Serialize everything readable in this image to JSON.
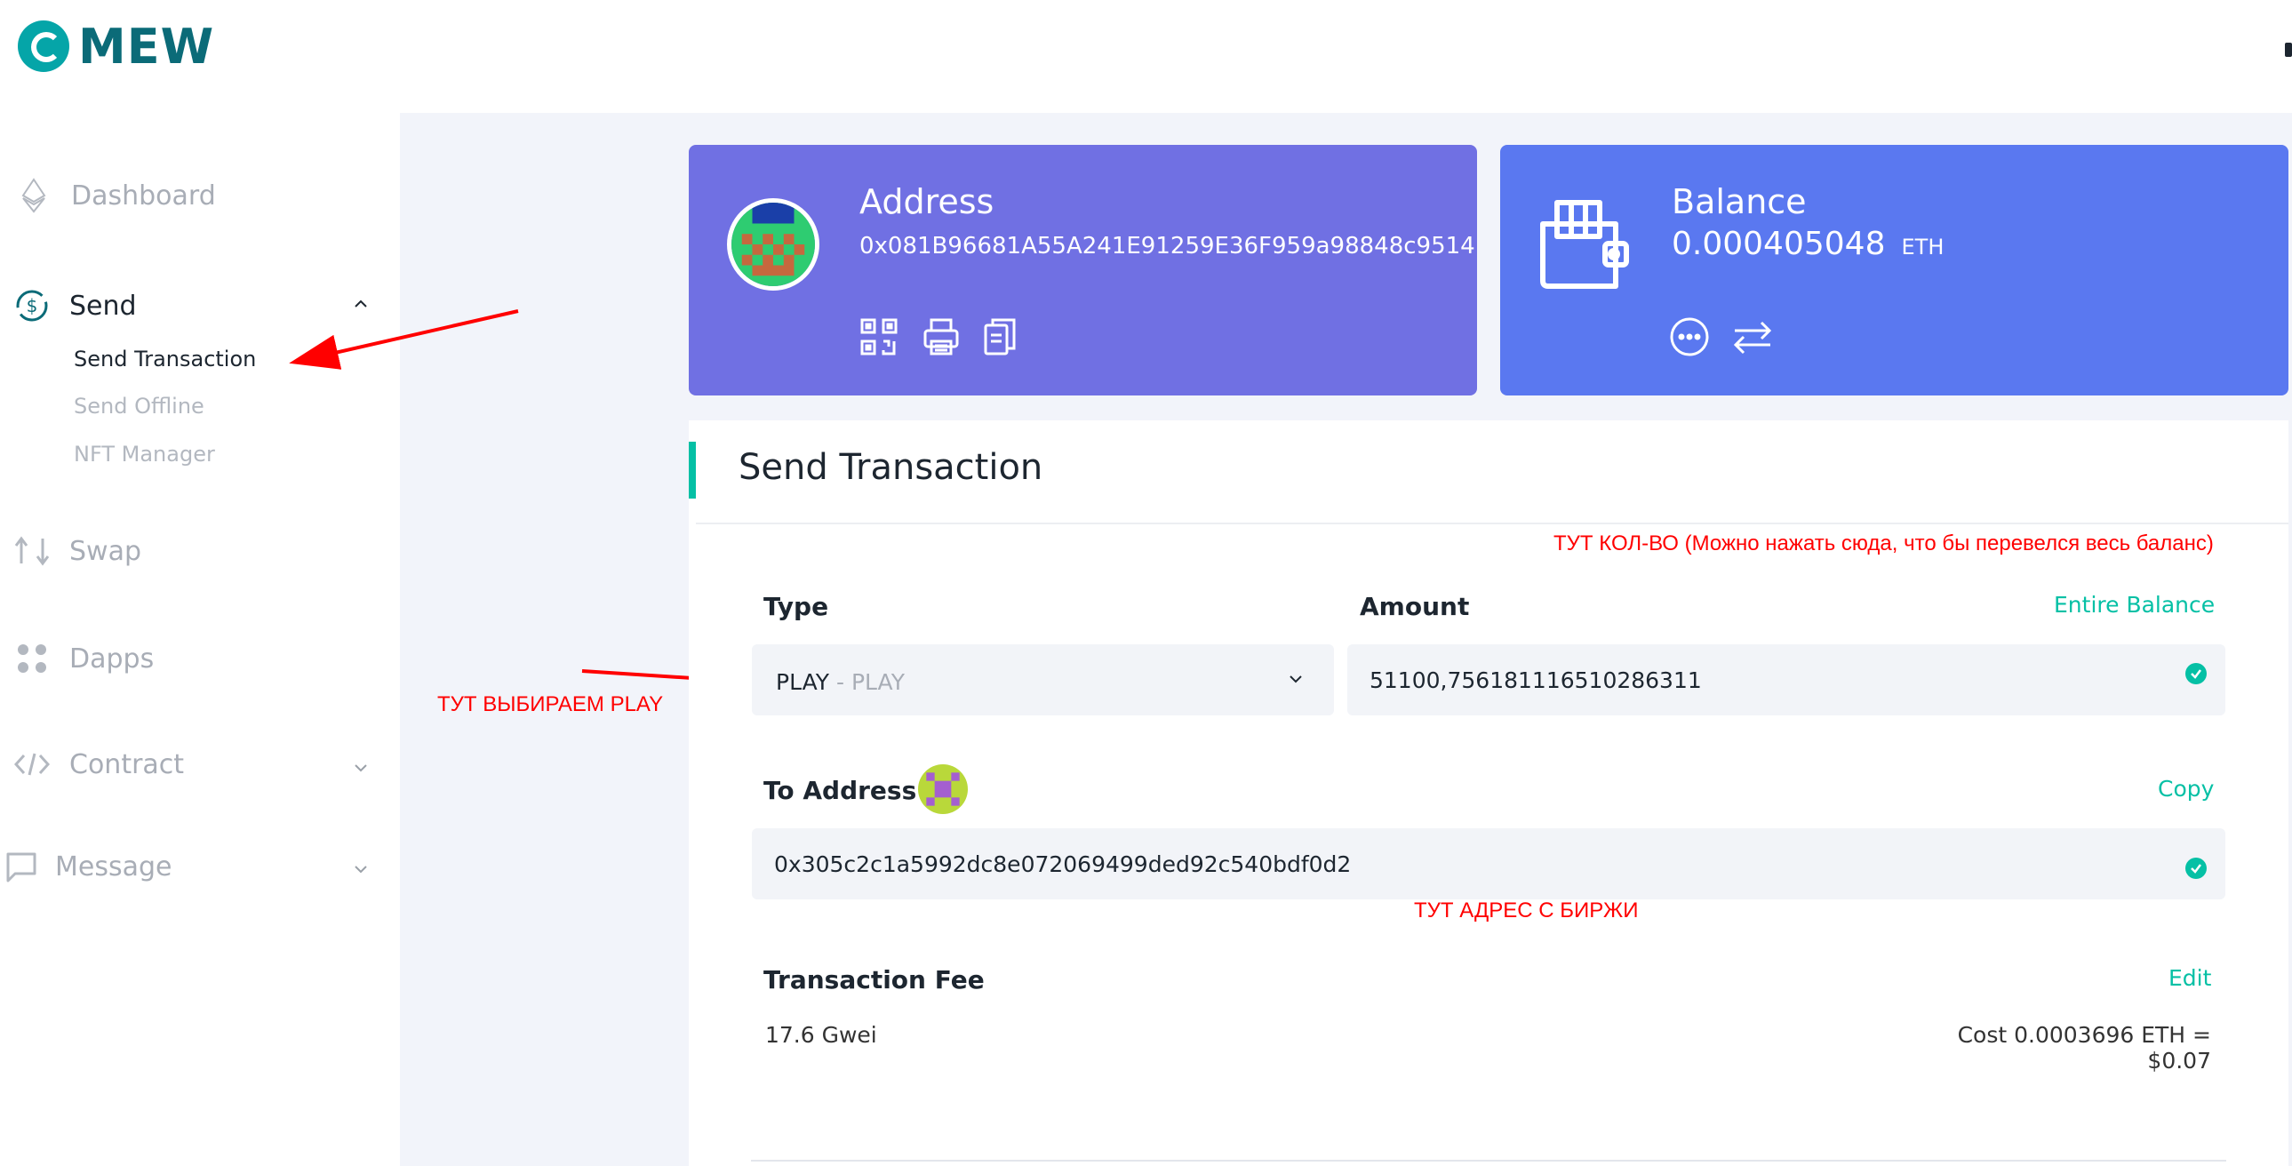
{
  "header": {
    "logo_text": "MEW"
  },
  "sidebar": {
    "dashboard": "Dashboard",
    "send": "Send",
    "send_items": [
      "Send Transaction",
      "Send Offline",
      "NFT Manager"
    ],
    "swap": "Swap",
    "dapps": "Dapps",
    "contract": "Contract",
    "message": "Message"
  },
  "address_card": {
    "title": "Address",
    "address": "0x081B96681A55A241E91259E36F959a98848c9514",
    "icons": [
      "qr-code-icon",
      "printer-icon",
      "copy-icon"
    ]
  },
  "balance_card": {
    "title": "Balance",
    "amount": "0.000405048",
    "unit": "ETH",
    "icons": [
      "more-icon",
      "swap-icon"
    ]
  },
  "send_panel": {
    "title": "Send Transaction",
    "type_label": "Type",
    "type_value": "PLAY",
    "type_sub": "- PLAY",
    "amount_label": "Amount",
    "entire_balance": "Entire Balance",
    "amount_value": "51100,756181116510286311",
    "to_address_label": "To Address",
    "copy_label": "Copy",
    "to_address_value": "0x305c2c1a5992dc8e072069499ded92c540bdf0d2",
    "fee_label": "Transaction Fee",
    "edit_label": "Edit",
    "fee_gwei": "17.6 Gwei",
    "fee_cost": "Cost 0.0003696 ETH = $0.07"
  },
  "annotations": {
    "amount_note": "ТУТ КОЛ-ВО (Можно нажать сюда, что бы перевелся весь баланс)",
    "type_note": "ТУТ ВЫБИРАЕМ PLAY",
    "address_note": "ТУТ АДРЕС С БИРЖИ"
  },
  "colors": {
    "accent": "#05c0a5",
    "address_card": "#7070e3",
    "balance_card": "#5a78f0",
    "annotation": "#ff0000"
  }
}
